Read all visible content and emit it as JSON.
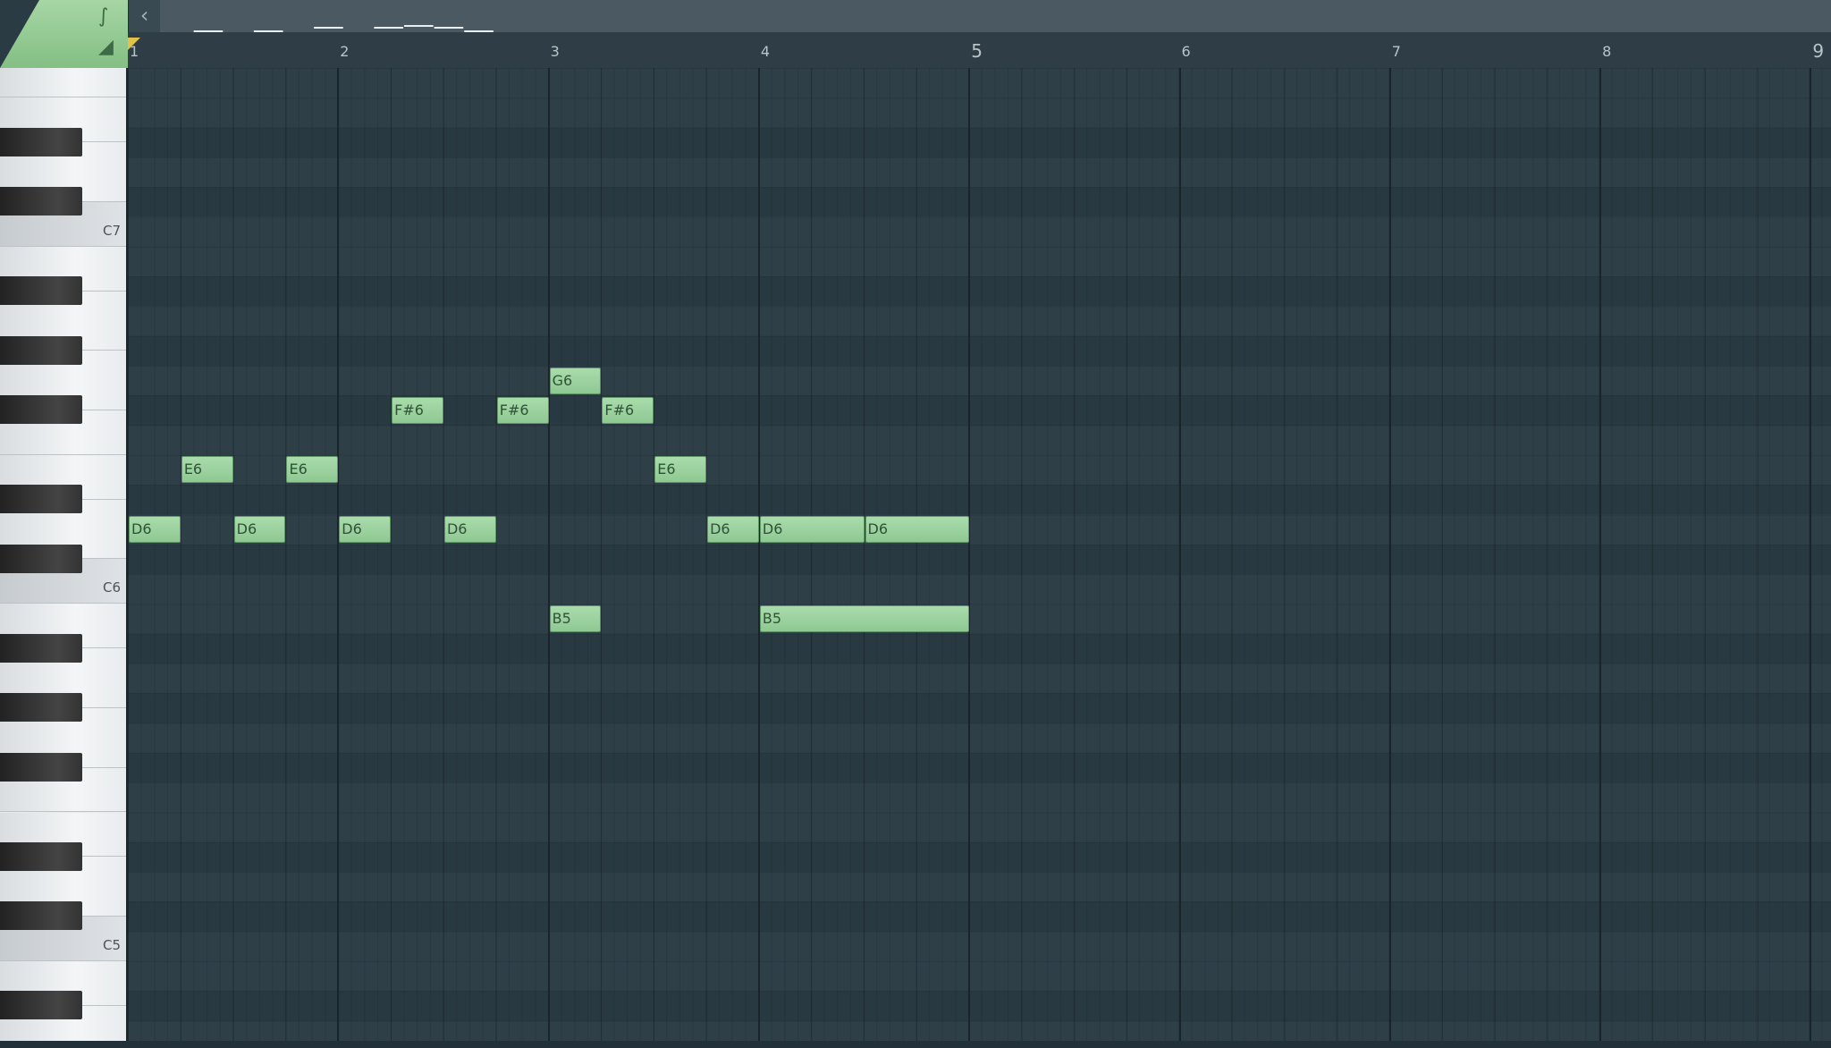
{
  "toolbar": {
    "curve_icon": "curve-icon",
    "ramp_icon": "ramp-icon",
    "collapse_glyph": "‹"
  },
  "ruler": {
    "bars": [
      "1",
      "2",
      "3",
      "4",
      "5",
      "6",
      "7",
      "8",
      "9"
    ]
  },
  "keyboard": {
    "labels": [
      "C7",
      "C6",
      "C5"
    ]
  },
  "notes": [
    {
      "label": "D6",
      "start": 0,
      "length": 0.25
    },
    {
      "label": "E6",
      "start": 0.25,
      "length": 0.25
    },
    {
      "label": "D6",
      "start": 0.5,
      "length": 0.25
    },
    {
      "label": "E6",
      "start": 0.75,
      "length": 0.25
    },
    {
      "label": "D6",
      "start": 1,
      "length": 0.25
    },
    {
      "label": "F#6",
      "start": 1.25,
      "length": 0.25
    },
    {
      "label": "D6",
      "start": 1.5,
      "length": 0.25
    },
    {
      "label": "F#6",
      "start": 1.75,
      "length": 0.25
    },
    {
      "label": "G6",
      "start": 2,
      "length": 0.25
    },
    {
      "label": "B5",
      "start": 2,
      "length": 0.25
    },
    {
      "label": "F#6",
      "start": 2.25,
      "length": 0.25
    },
    {
      "label": "E6",
      "start": 2.5,
      "length": 0.25
    },
    {
      "label": "D6",
      "start": 2.75,
      "length": 0.25
    },
    {
      "label": "D6",
      "start": 3,
      "length": 0.5
    },
    {
      "label": "B5",
      "start": 3,
      "length": 1
    },
    {
      "label": "D6",
      "start": 3.5,
      "length": 0.5
    }
  ],
  "colors": {
    "note_fill": "#9ed3a1",
    "grid_bg": "#2e3f48",
    "accent_green": "#94cb94"
  }
}
